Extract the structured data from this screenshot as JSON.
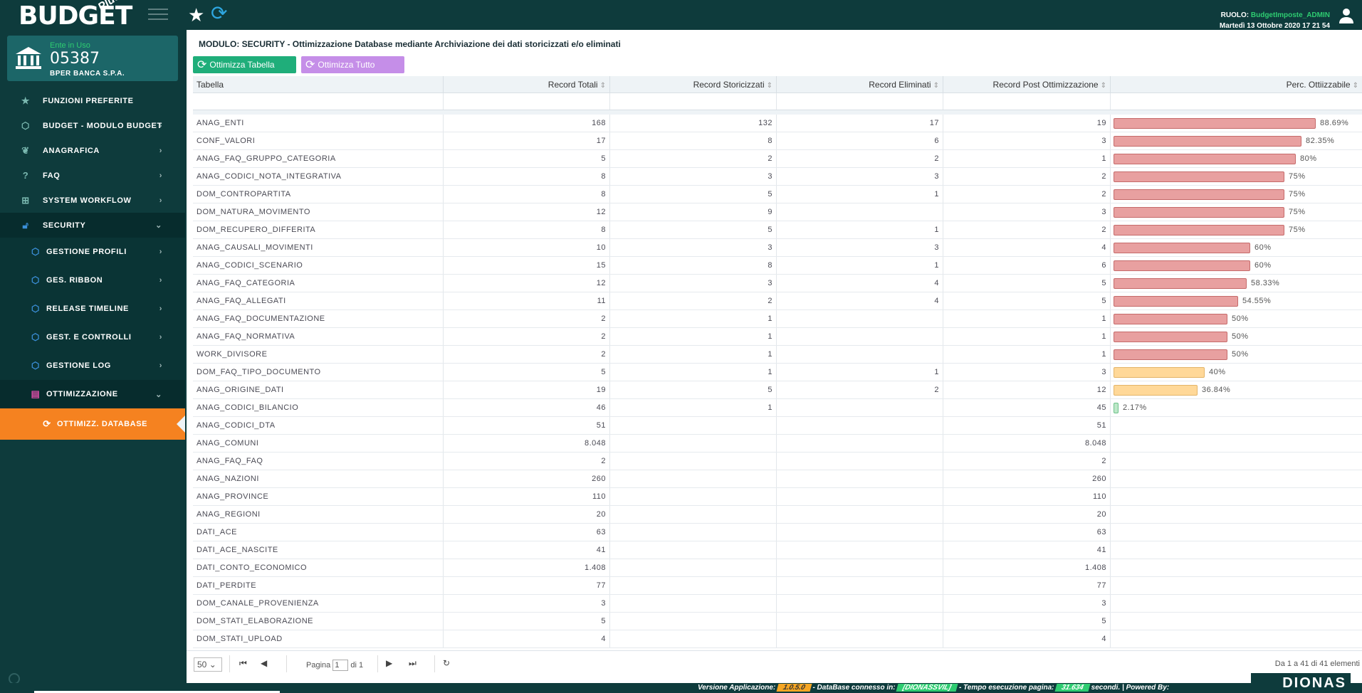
{
  "header": {
    "logo_text": "BUDGET",
    "logo_plus": "Plus",
    "role_label": "RUOLO:",
    "role_value": "BudgetImposte_ADMIN",
    "datetime": "Martedì 13 Ottobre 2020  17 21 54"
  },
  "ente": {
    "label": "Ente in Uso",
    "code": "05387",
    "name": "BPER BANCA S.P.A."
  },
  "sidebar": {
    "items": [
      {
        "label": "FUNZIONI PREFERITE",
        "icon": "star-icon"
      },
      {
        "label": "BUDGET - MODULO BUDGET",
        "icon": "cube-icon"
      },
      {
        "label": "ANAGRAFICA",
        "icon": "plant-icon"
      },
      {
        "label": "FAQ",
        "icon": "question-icon"
      },
      {
        "label": "SYSTEM WORKFLOW",
        "icon": "sitemap-icon"
      },
      {
        "label": "SECURITY",
        "icon": "unlock-icon"
      }
    ],
    "security_sub": [
      {
        "label": "GESTIONE PROFILI",
        "icon": "cube-icon"
      },
      {
        "label": "GES. RIBBON",
        "icon": "cube-icon"
      },
      {
        "label": "RELEASE TIMELINE",
        "icon": "cube-icon"
      },
      {
        "label": "GEST. E CONTROLLI",
        "icon": "cube-icon"
      },
      {
        "label": "GESTIONE LOG",
        "icon": "cube-icon"
      }
    ],
    "ottimizzazione": {
      "label": "OTTIMIZZAZIONE",
      "icon": "database-icon"
    },
    "current": {
      "label": "OTTIMIZZ. DATABASE",
      "icon": "refresh-icon"
    }
  },
  "main": {
    "module_title": "MODULO: SECURITY - Ottimizzazione Database mediante Archiviazione dei dati storicizzati e/o eliminati",
    "btn_optimize_table": "Ottimizza Tabella",
    "btn_optimize_all": "Ottimizza Tutto",
    "columns": [
      "Tabella",
      "Record Totali",
      "Record Storicizzati",
      "Record Eliminati",
      "Record Post Ottimizzazione",
      "Perc. Ottiizzabile"
    ],
    "rows": [
      {
        "t": "ANAG_ENTI",
        "tot": "168",
        "sto": "132",
        "eli": "17",
        "post": "19",
        "pct": 88.69,
        "pct_label": "88.69%"
      },
      {
        "t": "CONF_VALORI",
        "tot": "17",
        "sto": "8",
        "eli": "6",
        "post": "3",
        "pct": 82.35,
        "pct_label": "82.35%"
      },
      {
        "t": "ANAG_FAQ_GRUPPO_CATEGORIA",
        "tot": "5",
        "sto": "2",
        "eli": "2",
        "post": "1",
        "pct": 80,
        "pct_label": "80%"
      },
      {
        "t": "ANAG_CODICI_NOTA_INTEGRATIVA",
        "tot": "8",
        "sto": "3",
        "eli": "3",
        "post": "2",
        "pct": 75,
        "pct_label": "75%"
      },
      {
        "t": "DOM_CONTROPARTITA",
        "tot": "8",
        "sto": "5",
        "eli": "1",
        "post": "2",
        "pct": 75,
        "pct_label": "75%"
      },
      {
        "t": "DOM_NATURA_MOVIMENTO",
        "tot": "12",
        "sto": "9",
        "eli": "",
        "post": "3",
        "pct": 75,
        "pct_label": "75%"
      },
      {
        "t": "DOM_RECUPERO_DIFFERITA",
        "tot": "8",
        "sto": "5",
        "eli": "1",
        "post": "2",
        "pct": 75,
        "pct_label": "75%"
      },
      {
        "t": "ANAG_CAUSALI_MOVIMENTI",
        "tot": "10",
        "sto": "3",
        "eli": "3",
        "post": "4",
        "pct": 60,
        "pct_label": "60%"
      },
      {
        "t": "ANAG_CODICI_SCENARIO",
        "tot": "15",
        "sto": "8",
        "eli": "1",
        "post": "6",
        "pct": 60,
        "pct_label": "60%"
      },
      {
        "t": "ANAG_FAQ_CATEGORIA",
        "tot": "12",
        "sto": "3",
        "eli": "4",
        "post": "5",
        "pct": 58.33,
        "pct_label": "58.33%"
      },
      {
        "t": "ANAG_FAQ_ALLEGATI",
        "tot": "11",
        "sto": "2",
        "eli": "4",
        "post": "5",
        "pct": 54.55,
        "pct_label": "54.55%"
      },
      {
        "t": "ANAG_FAQ_DOCUMENTAZIONE",
        "tot": "2",
        "sto": "1",
        "eli": "",
        "post": "1",
        "pct": 50,
        "pct_label": "50%"
      },
      {
        "t": "ANAG_FAQ_NORMATIVA",
        "tot": "2",
        "sto": "1",
        "eli": "",
        "post": "1",
        "pct": 50,
        "pct_label": "50%"
      },
      {
        "t": "WORK_DIVISORE",
        "tot": "2",
        "sto": "1",
        "eli": "",
        "post": "1",
        "pct": 50,
        "pct_label": "50%"
      },
      {
        "t": "DOM_FAQ_TIPO_DOCUMENTO",
        "tot": "5",
        "sto": "1",
        "eli": "1",
        "post": "3",
        "pct": 40,
        "pct_label": "40%"
      },
      {
        "t": "ANAG_ORIGINE_DATI",
        "tot": "19",
        "sto": "5",
        "eli": "2",
        "post": "12",
        "pct": 36.84,
        "pct_label": "36.84%"
      },
      {
        "t": "ANAG_CODICI_BILANCIO",
        "tot": "46",
        "sto": "1",
        "eli": "",
        "post": "45",
        "pct": 2.17,
        "pct_label": "2.17%"
      },
      {
        "t": "ANAG_CODICI_DTA",
        "tot": "51",
        "sto": "",
        "eli": "",
        "post": "51",
        "pct": null,
        "pct_label": ""
      },
      {
        "t": "ANAG_COMUNI",
        "tot": "8.048",
        "sto": "",
        "eli": "",
        "post": "8.048",
        "pct": null,
        "pct_label": ""
      },
      {
        "t": "ANAG_FAQ_FAQ",
        "tot": "2",
        "sto": "",
        "eli": "",
        "post": "2",
        "pct": null,
        "pct_label": ""
      },
      {
        "t": "ANAG_NAZIONI",
        "tot": "260",
        "sto": "",
        "eli": "",
        "post": "260",
        "pct": null,
        "pct_label": ""
      },
      {
        "t": "ANAG_PROVINCE",
        "tot": "110",
        "sto": "",
        "eli": "",
        "post": "110",
        "pct": null,
        "pct_label": ""
      },
      {
        "t": "ANAG_REGIONI",
        "tot": "20",
        "sto": "",
        "eli": "",
        "post": "20",
        "pct": null,
        "pct_label": ""
      },
      {
        "t": "DATI_ACE",
        "tot": "63",
        "sto": "",
        "eli": "",
        "post": "63",
        "pct": null,
        "pct_label": ""
      },
      {
        "t": "DATI_ACE_NASCITE",
        "tot": "41",
        "sto": "",
        "eli": "",
        "post": "41",
        "pct": null,
        "pct_label": ""
      },
      {
        "t": "DATI_CONTO_ECONOMICO",
        "tot": "1.408",
        "sto": "",
        "eli": "",
        "post": "1.408",
        "pct": null,
        "pct_label": ""
      },
      {
        "t": "DATI_PERDITE",
        "tot": "77",
        "sto": "",
        "eli": "",
        "post": "77",
        "pct": null,
        "pct_label": ""
      },
      {
        "t": "DOM_CANALE_PROVENIENZA",
        "tot": "3",
        "sto": "",
        "eli": "",
        "post": "3",
        "pct": null,
        "pct_label": ""
      },
      {
        "t": "DOM_STATI_ELABORAZIONE",
        "tot": "5",
        "sto": "",
        "eli": "",
        "post": "5",
        "pct": null,
        "pct_label": ""
      },
      {
        "t": "DOM_STATI_UPLOAD",
        "tot": "4",
        "sto": "",
        "eli": "",
        "post": "4",
        "pct": null,
        "pct_label": ""
      }
    ]
  },
  "pager": {
    "page_size": "50",
    "page_label": "Pagina",
    "page_value": "1",
    "of_label": "di 1",
    "info": "Da 1 a 41 di 41 elementi"
  },
  "statusbar": {
    "version_label": "Versione Applicazione:",
    "version": "1.0.5.0",
    "db_label": "- DataBase connesso in:",
    "db": "[DIONASSVIL]",
    "time_label": "- Tempo esecuzione pagina:",
    "time": "31.634",
    "seconds_label": "secondi.",
    "powered_label": "| Powered By:",
    "brand": "DIONAS"
  },
  "colors": {
    "bg_dark": "#0e3b3c",
    "accent_orange": "#f58220",
    "btn_green": "#1fae7a",
    "btn_purple": "#c58ee8",
    "role_green": "#2ecc71"
  }
}
